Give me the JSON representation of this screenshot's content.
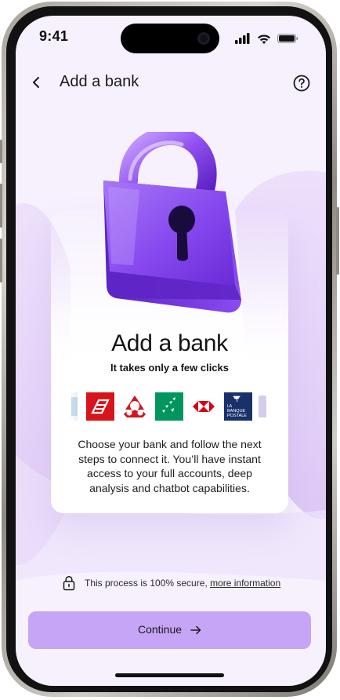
{
  "status_bar": {
    "time": "9:41",
    "icons": [
      "signal-icon",
      "wifi-icon",
      "battery-icon"
    ]
  },
  "nav": {
    "back_icon": "chevron-left-icon",
    "title": "Add a bank",
    "help_icon": "question-circle-icon"
  },
  "hero": {
    "illustration": "padlock-illustration",
    "accent_color": "#7b3fe4"
  },
  "card": {
    "title": "Add a bank",
    "subtitle": "It takes only a few clicks",
    "bank_logos": [
      "bank-logo-partial-left",
      "caisse-epargne-logo",
      "credit-agricole-logo",
      "bnp-paribas-logo",
      "hsbc-logo",
      "la-banque-postale-logo",
      "bank-logo-partial-right"
    ],
    "la_banque_postale_text": "LA BANQUE POSTALE",
    "body": "Choose your bank and follow the next steps to connect it. You’ll have instant access to your full accounts, deep analysis and chatbot capabilities."
  },
  "security": {
    "icon": "lock-icon",
    "text": "This process is 100% secure, ",
    "link": "more information"
  },
  "cta": {
    "label": "Continue",
    "icon": "arrow-right-icon",
    "color": "#c6a4f6"
  }
}
